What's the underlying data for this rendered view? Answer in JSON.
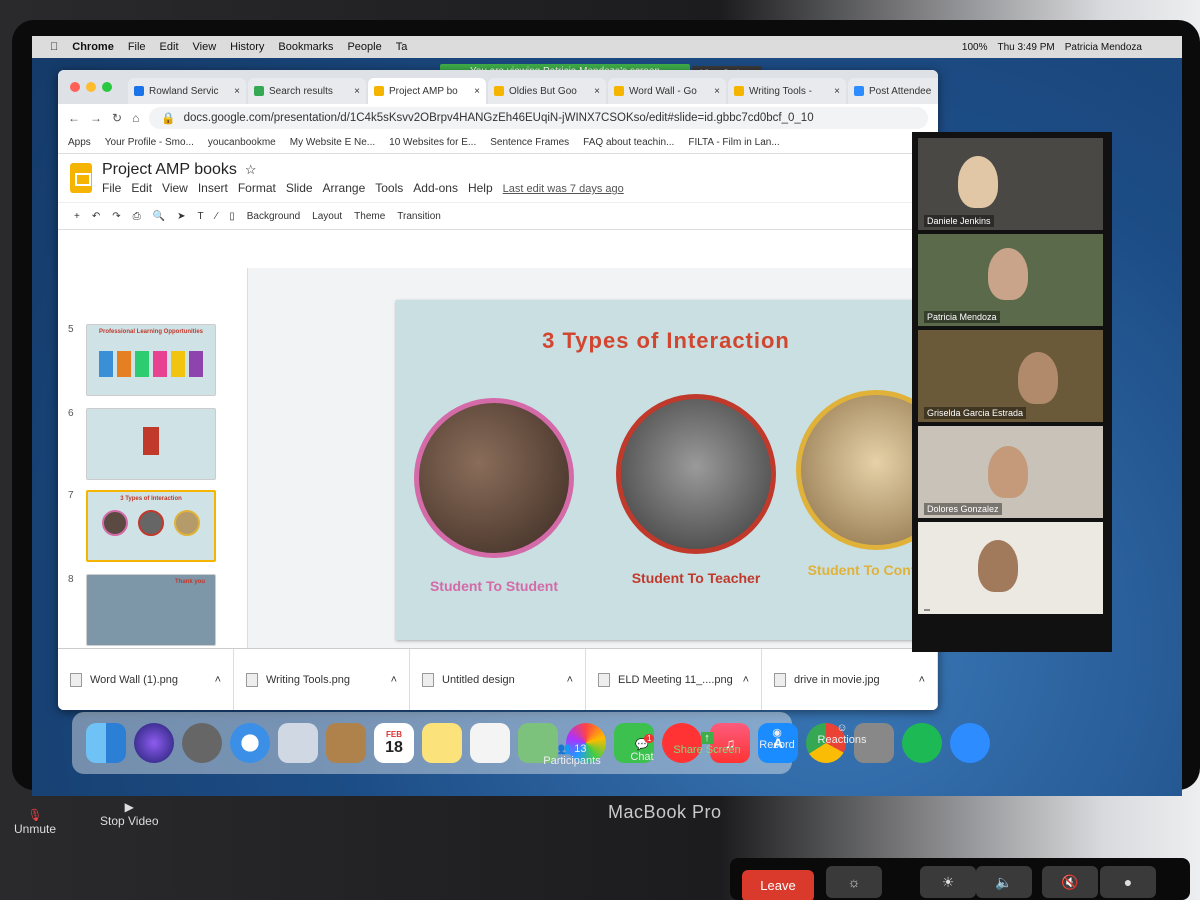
{
  "menubar": {
    "items": [
      "Chrome",
      "File",
      "Edit",
      "View",
      "History",
      "Bookmarks",
      "People",
      "Ta"
    ],
    "clock": "Thu 3:49 PM",
    "user": "Patricia Mendoza",
    "battery": "100%"
  },
  "zoom_banner": {
    "text": "You are viewing Patricia Mendoza's screen",
    "view_options": "View Options"
  },
  "tabs": [
    {
      "label": "Rowland Servic",
      "color": "#1a73e8"
    },
    {
      "label": "Search results",
      "color": "#34a853"
    },
    {
      "label": "Project AMP bo",
      "color": "#f4b400"
    },
    {
      "label": "Oldies But Goo",
      "color": "#f4b400"
    },
    {
      "label": "Word Wall - Go",
      "color": "#f4b400"
    },
    {
      "label": "Writing Tools -",
      "color": "#f4b400"
    },
    {
      "label": "Post Attendee",
      "color": "#2d8cff"
    }
  ],
  "url": "docs.google.com/presentation/d/1C4k5sKsvv2OBrpv4HANGzEh46EUqiN-jWINX7CSOKso/edit#slide=id.gbbc7cd0bcf_0_10",
  "bookmarks": [
    "Apps",
    "Your Profile - Smo...",
    "youcanbookme",
    "My Website E Ne...",
    "10 Websites for E...",
    "Sentence Frames",
    "FAQ about teachin...",
    "FILTA - Film in Lan..."
  ],
  "doc": {
    "title": "Project AMP books",
    "menus": [
      "File",
      "Edit",
      "View",
      "Insert",
      "Format",
      "Slide",
      "Arrange",
      "Tools",
      "Add-ons",
      "Help"
    ],
    "last_edit": "Last edit was 7 days ago"
  },
  "toolbar": {
    "items": [
      "Background",
      "Layout",
      "Theme",
      "Transition"
    ]
  },
  "filmstrip": [
    {
      "num": "5",
      "title": "Professional Learning Opportunities"
    },
    {
      "num": "6",
      "title": ""
    },
    {
      "num": "7",
      "title": "3 Types of Interaction"
    },
    {
      "num": "8",
      "title": "Thank you"
    }
  ],
  "slide": {
    "title": "3 Types of Interaction",
    "captions": [
      {
        "text": "Student To Student",
        "color": "#d46aa8"
      },
      {
        "text": "Student To Teacher",
        "color": "#c0392b"
      },
      {
        "text": "Student To Content",
        "color": "#e0b23a"
      }
    ]
  },
  "downloads": [
    "Word Wall (1).png",
    "Writing Tools.png",
    "Untitled design",
    "ELD Meeting 11_....png",
    "drive in movie.jpg"
  ],
  "participants_gallery": [
    "Daniele Jenkins",
    "Patricia Mendoza",
    "Griselda Garcia Estrada",
    "Dolores Gonzalez",
    ""
  ],
  "dock_date": {
    "month": "FEB",
    "day": "18"
  },
  "zoom_controls": {
    "participants_count": "13",
    "participants": "Participants",
    "chat": "Chat",
    "chat_badge": "1",
    "share": "Share Screen",
    "record": "Record",
    "reactions": "Reactions",
    "unmute": "Unmute",
    "stop_video": "Stop Video",
    "leave": "Leave"
  },
  "laptop_brand": "MacBook Pro"
}
